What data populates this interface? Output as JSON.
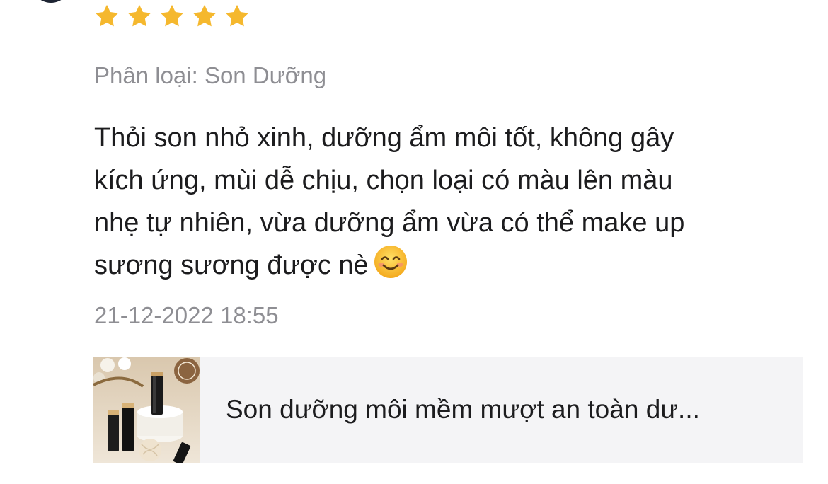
{
  "review": {
    "rating": 5,
    "rating_max": 5,
    "star_color": "#f5b82e",
    "variation": "Phân loại: Son Dưỡng",
    "text_lines": [
      "Thỏi son nhỏ xinh, dưỡng ẩm môi tốt, không gây",
      "kích ứng, mùi dễ chịu, chọn loại có màu lên màu",
      "nhẹ tự nhiên, vừa dưỡng ẩm vừa có thể make up",
      "sương sương được nè"
    ],
    "emoji": "smiling-face-emoji",
    "timestamp": "21-12-2022 18:55"
  },
  "product": {
    "name": "Son dưỡng môi mềm mượt an toàn dư...",
    "thumbnail_icon": "lip-balm-product-photo"
  }
}
